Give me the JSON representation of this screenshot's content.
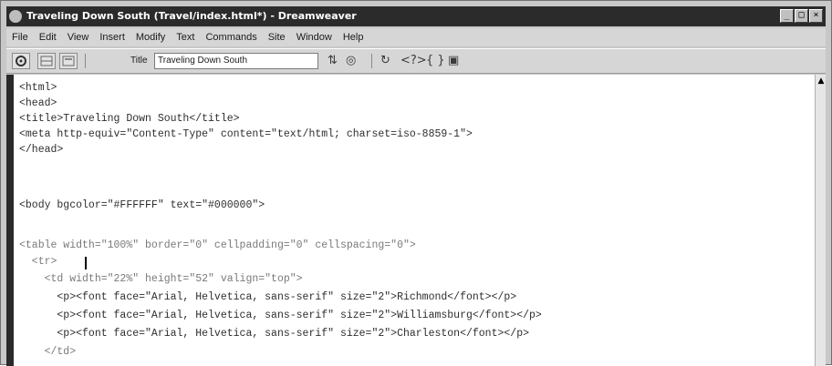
{
  "window": {
    "title": "Traveling Down South (Travel/index.html*) - Dreamweaver",
    "controls": {
      "minimize": "_",
      "maximize": "□",
      "close": "×"
    }
  },
  "menubar": {
    "items": [
      "File",
      "Edit",
      "View",
      "Insert",
      "Modify",
      "Text",
      "Commands",
      "Site",
      "Window",
      "Help"
    ]
  },
  "toolbar": {
    "title_label": "Title",
    "title_value": "Traveling Down South",
    "icons": [
      "view-code-icon",
      "view-split-icon",
      "view-design-icon",
      "file-management-icon",
      "preview-browser-icon",
      "refresh-icon",
      "code-navigation-icon",
      "reference-icon",
      "view-options-icon"
    ],
    "glyphs": {
      "file_mgmt": "⇅",
      "preview": "◎",
      "refresh": "↻",
      "tag": "<?>",
      "braces": "{ }",
      "options": "▣"
    }
  },
  "code": {
    "lines": [
      "<html>",
      "<head>",
      "<title>Traveling Down South</title>",
      "<meta http-equiv=\"Content-Type\" content=\"text/html; charset=iso-8859-1\">",
      "</head>",
      "",
      "<body bgcolor=\"#FFFFFF\" text=\"#000000\">",
      "",
      "<table width=\"100%\" border=\"0\" cellpadding=\"0\" cellspacing=\"0\">",
      "  <tr>",
      "    <td width=\"22%\" height=\"52\" valign=\"top\">",
      "      <p><font face=\"Arial, Helvetica, sans-serif\" size=\"2\">Richmond</font></p>",
      "      <p><font face=\"Arial, Helvetica, sans-serif\" size=\"2\">Williamsburg</font></p>",
      "      <p><font face=\"Arial, Helvetica, sans-serif\" size=\"2\">Charleston</font></p>",
      "    </td>"
    ]
  },
  "scrollbar": {
    "up_arrow": "▲"
  },
  "colors": {
    "titlebar": "#2b2b2b",
    "chrome": "#d6d6d6",
    "code_text": "#2e2e2e"
  }
}
